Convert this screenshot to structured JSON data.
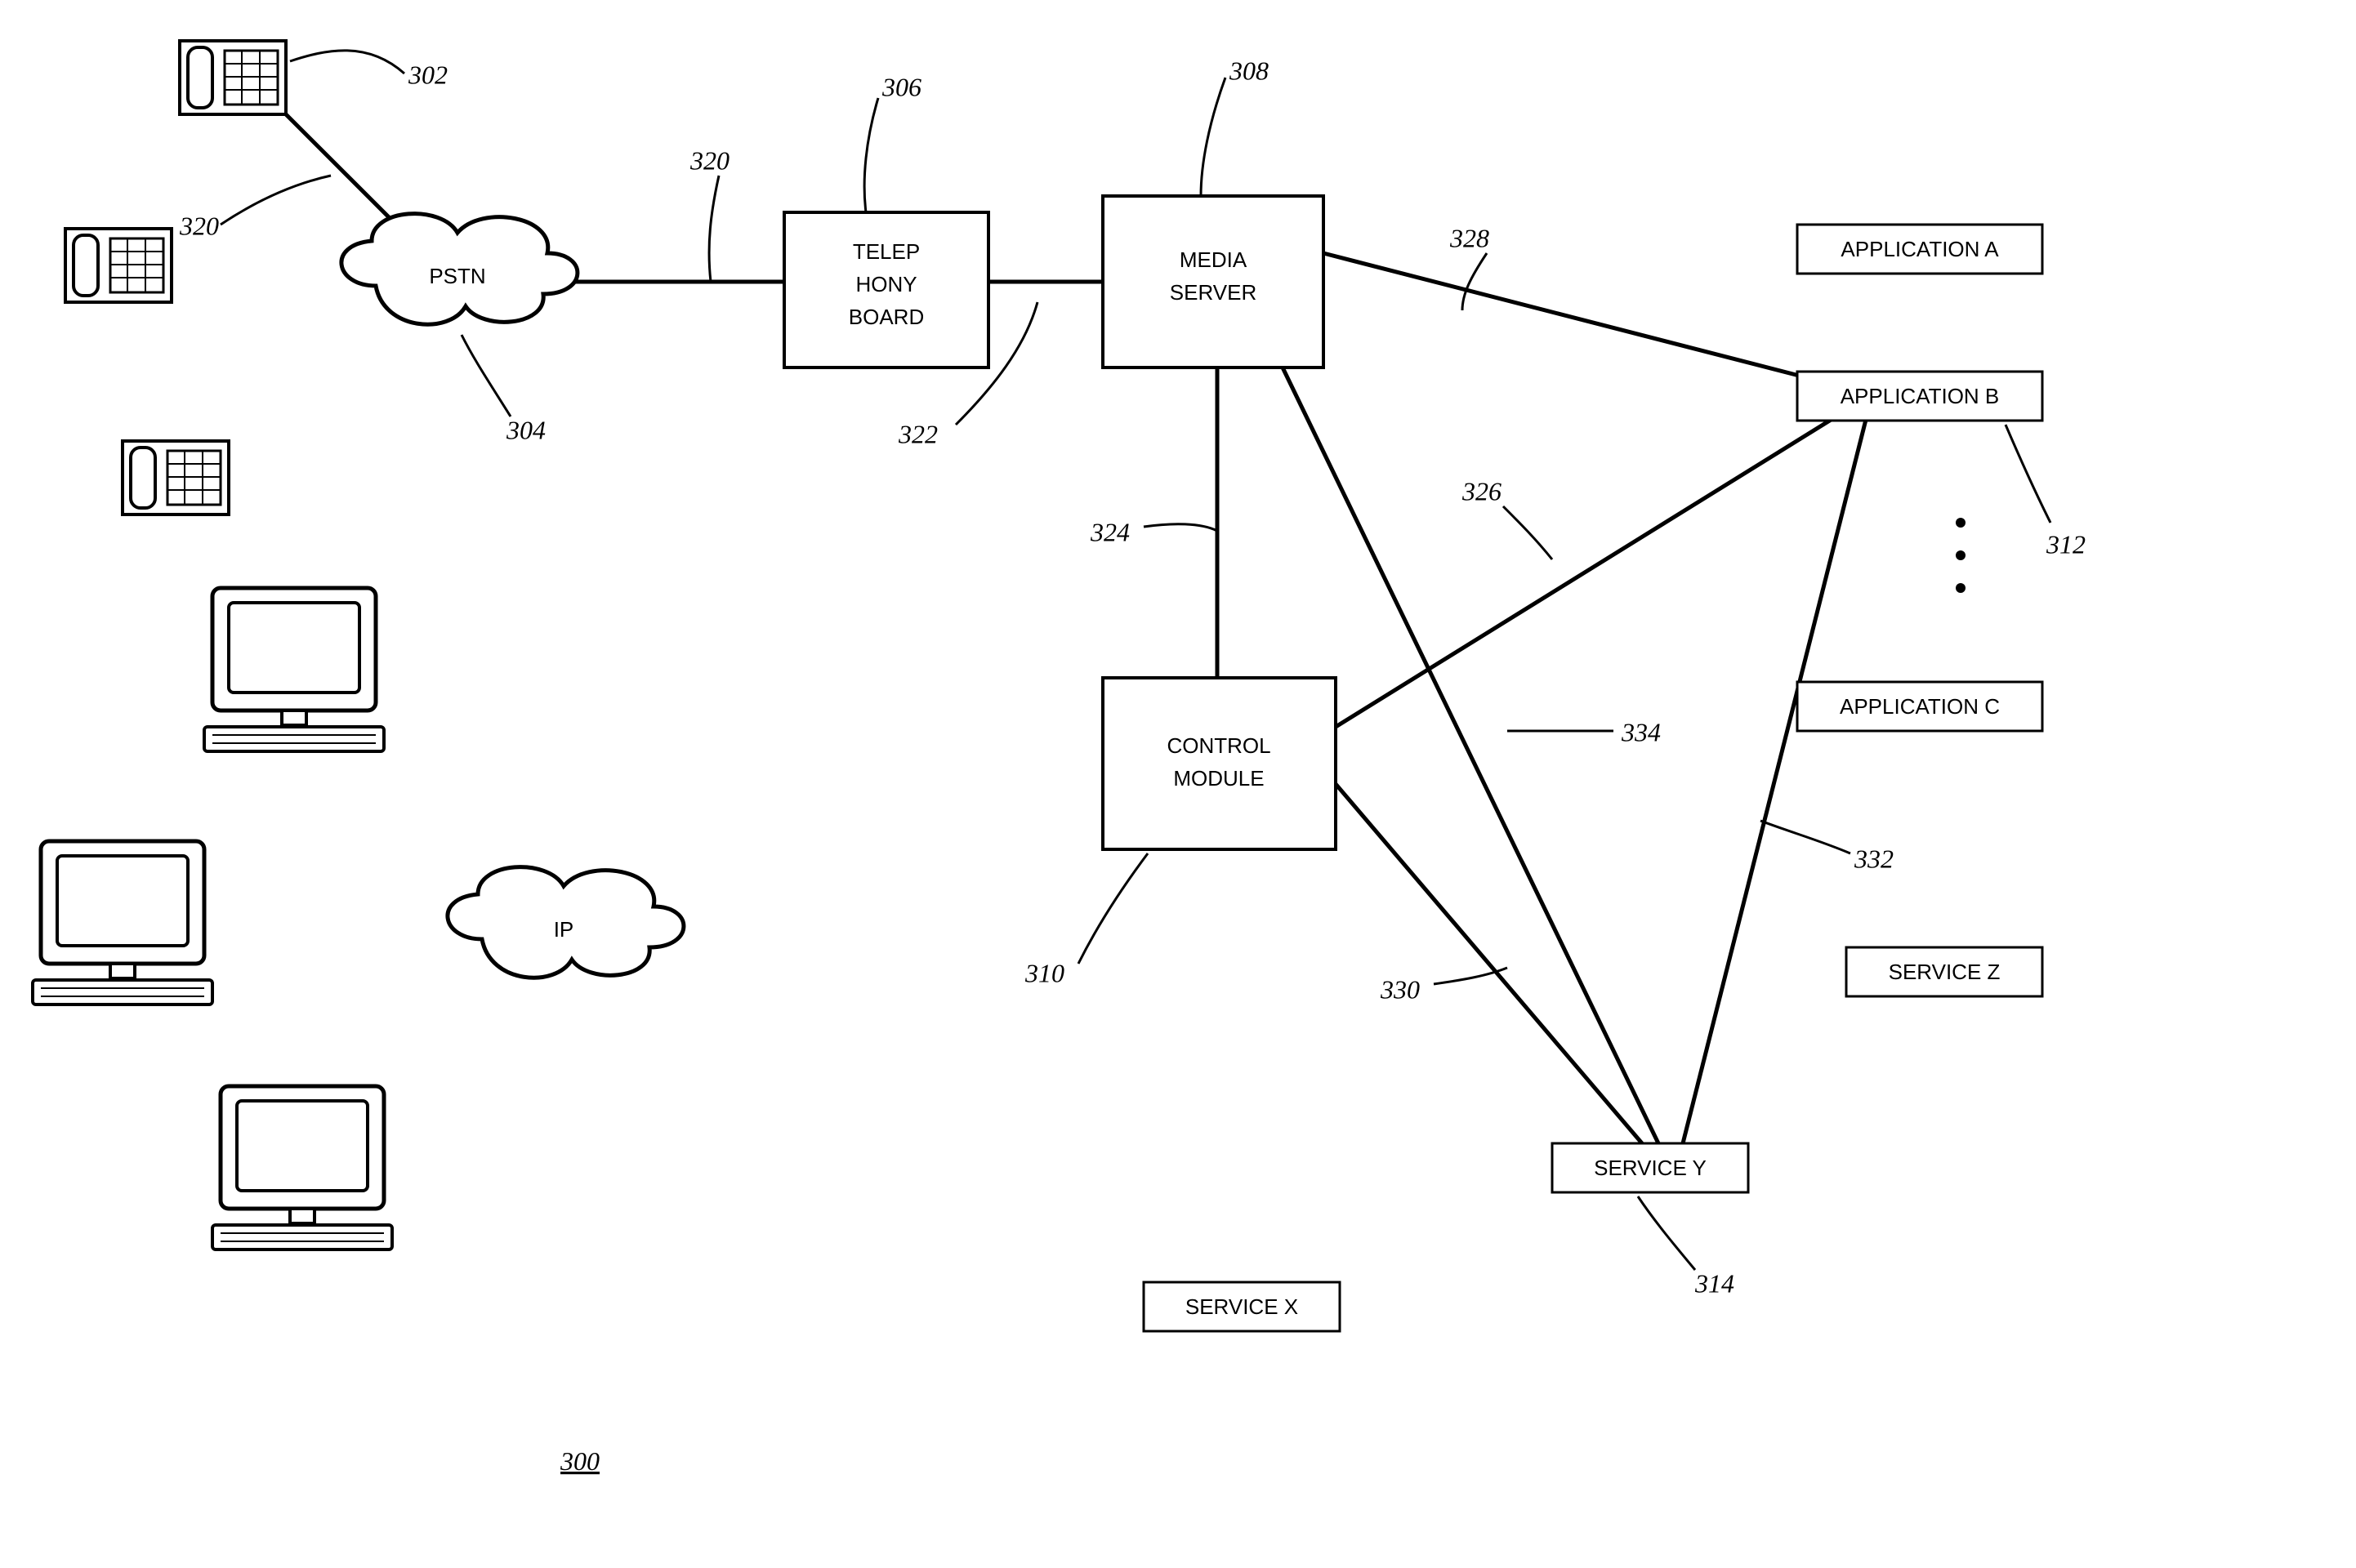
{
  "nodes": {
    "pstn": "PSTN",
    "ip": "IP",
    "telephony_board_l1": "TELEP",
    "telephony_board_l2": "HONY",
    "telephony_board_l3": "BOARD",
    "media_server_l1": "MEDIA",
    "media_server_l2": "SERVER",
    "control_module_l1": "CONTROL",
    "control_module_l2": "MODULE",
    "app_a": "APPLICATION A",
    "app_b": "APPLICATION B",
    "app_c": "APPLICATION C",
    "service_x": "SERVICE X",
    "service_y": "SERVICE Y",
    "service_z": "SERVICE Z"
  },
  "refs": {
    "r300": "300",
    "r302": "302",
    "r304": "304",
    "r306": "306",
    "r308": "308",
    "r310": "310",
    "r312": "312",
    "r314": "314",
    "r320a": "320",
    "r320b": "320",
    "r322": "322",
    "r324": "324",
    "r326": "326",
    "r328": "328",
    "r330": "330",
    "r332": "332",
    "r334": "334"
  },
  "chart_data": {
    "type": "network-diagram",
    "figure_number": "300",
    "nodes": [
      {
        "id": "phone1",
        "type": "telephone-device",
        "ref": "302"
      },
      {
        "id": "phone2",
        "type": "telephone-device"
      },
      {
        "id": "phone3",
        "type": "telephone-device"
      },
      {
        "id": "pc1",
        "type": "computer-device"
      },
      {
        "id": "pc2",
        "type": "computer-device"
      },
      {
        "id": "pc3",
        "type": "computer-device"
      },
      {
        "id": "pstn",
        "type": "cloud",
        "label": "PSTN",
        "ref": "304"
      },
      {
        "id": "ip",
        "type": "cloud",
        "label": "IP"
      },
      {
        "id": "telephony_board",
        "type": "box",
        "label": "TELEP HONY BOARD",
        "ref": "306"
      },
      {
        "id": "media_server",
        "type": "box",
        "label": "MEDIA SERVER",
        "ref": "308"
      },
      {
        "id": "control_module",
        "type": "box",
        "label": "CONTROL MODULE",
        "ref": "310"
      },
      {
        "id": "app_a",
        "type": "box",
        "label": "APPLICATION A"
      },
      {
        "id": "app_b",
        "type": "box",
        "label": "APPLICATION B",
        "ref": "312"
      },
      {
        "id": "app_c",
        "type": "box",
        "label": "APPLICATION C"
      },
      {
        "id": "service_x",
        "type": "box",
        "label": "SERVICE X"
      },
      {
        "id": "service_y",
        "type": "box",
        "label": "SERVICE Y",
        "ref": "314"
      },
      {
        "id": "service_z",
        "type": "box",
        "label": "SERVICE Z"
      }
    ],
    "edges": [
      {
        "from": "phone1",
        "to": "pstn",
        "ref": "320"
      },
      {
        "from": "pstn",
        "to": "telephony_board",
        "ref": "320"
      },
      {
        "from": "telephony_board",
        "to": "media_server",
        "ref": "322"
      },
      {
        "from": "media_server",
        "to": "control_module",
        "ref": "324"
      },
      {
        "from": "media_server",
        "to": "app_b",
        "ref": "328"
      },
      {
        "from": "media_server",
        "to": "service_y",
        "ref": "334"
      },
      {
        "from": "control_module",
        "to": "app_b",
        "ref": "326"
      },
      {
        "from": "control_module",
        "to": "service_y",
        "ref": "330"
      },
      {
        "from": "app_b",
        "to": "service_y",
        "ref": "332"
      }
    ]
  }
}
